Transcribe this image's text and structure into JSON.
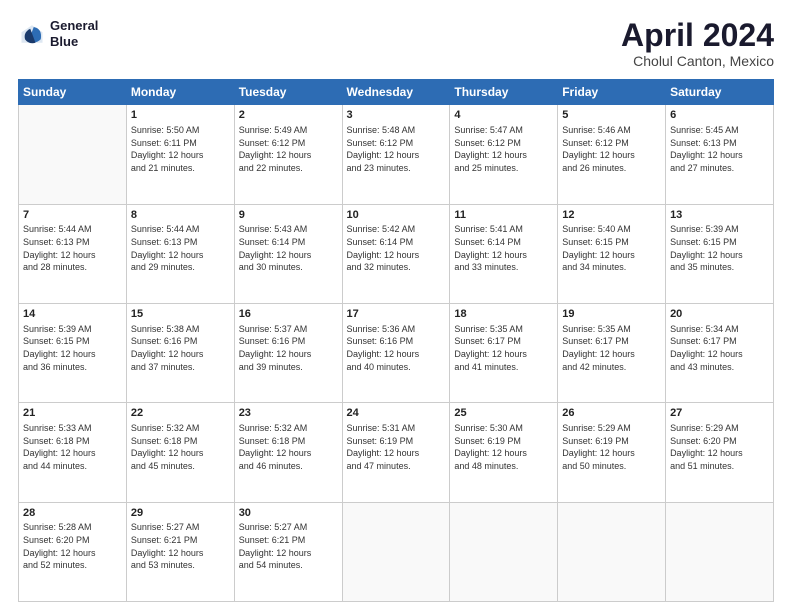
{
  "header": {
    "logo_line1": "General",
    "logo_line2": "Blue",
    "main_title": "April 2024",
    "subtitle": "Cholul Canton, Mexico"
  },
  "weekdays": [
    "Sunday",
    "Monday",
    "Tuesday",
    "Wednesday",
    "Thursday",
    "Friday",
    "Saturday"
  ],
  "weeks": [
    [
      {
        "day": "",
        "info": ""
      },
      {
        "day": "1",
        "info": "Sunrise: 5:50 AM\nSunset: 6:11 PM\nDaylight: 12 hours\nand 21 minutes."
      },
      {
        "day": "2",
        "info": "Sunrise: 5:49 AM\nSunset: 6:12 PM\nDaylight: 12 hours\nand 22 minutes."
      },
      {
        "day": "3",
        "info": "Sunrise: 5:48 AM\nSunset: 6:12 PM\nDaylight: 12 hours\nand 23 minutes."
      },
      {
        "day": "4",
        "info": "Sunrise: 5:47 AM\nSunset: 6:12 PM\nDaylight: 12 hours\nand 25 minutes."
      },
      {
        "day": "5",
        "info": "Sunrise: 5:46 AM\nSunset: 6:12 PM\nDaylight: 12 hours\nand 26 minutes."
      },
      {
        "day": "6",
        "info": "Sunrise: 5:45 AM\nSunset: 6:13 PM\nDaylight: 12 hours\nand 27 minutes."
      }
    ],
    [
      {
        "day": "7",
        "info": "Sunrise: 5:44 AM\nSunset: 6:13 PM\nDaylight: 12 hours\nand 28 minutes."
      },
      {
        "day": "8",
        "info": "Sunrise: 5:44 AM\nSunset: 6:13 PM\nDaylight: 12 hours\nand 29 minutes."
      },
      {
        "day": "9",
        "info": "Sunrise: 5:43 AM\nSunset: 6:14 PM\nDaylight: 12 hours\nand 30 minutes."
      },
      {
        "day": "10",
        "info": "Sunrise: 5:42 AM\nSunset: 6:14 PM\nDaylight: 12 hours\nand 32 minutes."
      },
      {
        "day": "11",
        "info": "Sunrise: 5:41 AM\nSunset: 6:14 PM\nDaylight: 12 hours\nand 33 minutes."
      },
      {
        "day": "12",
        "info": "Sunrise: 5:40 AM\nSunset: 6:15 PM\nDaylight: 12 hours\nand 34 minutes."
      },
      {
        "day": "13",
        "info": "Sunrise: 5:39 AM\nSunset: 6:15 PM\nDaylight: 12 hours\nand 35 minutes."
      }
    ],
    [
      {
        "day": "14",
        "info": "Sunrise: 5:39 AM\nSunset: 6:15 PM\nDaylight: 12 hours\nand 36 minutes."
      },
      {
        "day": "15",
        "info": "Sunrise: 5:38 AM\nSunset: 6:16 PM\nDaylight: 12 hours\nand 37 minutes."
      },
      {
        "day": "16",
        "info": "Sunrise: 5:37 AM\nSunset: 6:16 PM\nDaylight: 12 hours\nand 39 minutes."
      },
      {
        "day": "17",
        "info": "Sunrise: 5:36 AM\nSunset: 6:16 PM\nDaylight: 12 hours\nand 40 minutes."
      },
      {
        "day": "18",
        "info": "Sunrise: 5:35 AM\nSunset: 6:17 PM\nDaylight: 12 hours\nand 41 minutes."
      },
      {
        "day": "19",
        "info": "Sunrise: 5:35 AM\nSunset: 6:17 PM\nDaylight: 12 hours\nand 42 minutes."
      },
      {
        "day": "20",
        "info": "Sunrise: 5:34 AM\nSunset: 6:17 PM\nDaylight: 12 hours\nand 43 minutes."
      }
    ],
    [
      {
        "day": "21",
        "info": "Sunrise: 5:33 AM\nSunset: 6:18 PM\nDaylight: 12 hours\nand 44 minutes."
      },
      {
        "day": "22",
        "info": "Sunrise: 5:32 AM\nSunset: 6:18 PM\nDaylight: 12 hours\nand 45 minutes."
      },
      {
        "day": "23",
        "info": "Sunrise: 5:32 AM\nSunset: 6:18 PM\nDaylight: 12 hours\nand 46 minutes."
      },
      {
        "day": "24",
        "info": "Sunrise: 5:31 AM\nSunset: 6:19 PM\nDaylight: 12 hours\nand 47 minutes."
      },
      {
        "day": "25",
        "info": "Sunrise: 5:30 AM\nSunset: 6:19 PM\nDaylight: 12 hours\nand 48 minutes."
      },
      {
        "day": "26",
        "info": "Sunrise: 5:29 AM\nSunset: 6:19 PM\nDaylight: 12 hours\nand 50 minutes."
      },
      {
        "day": "27",
        "info": "Sunrise: 5:29 AM\nSunset: 6:20 PM\nDaylight: 12 hours\nand 51 minutes."
      }
    ],
    [
      {
        "day": "28",
        "info": "Sunrise: 5:28 AM\nSunset: 6:20 PM\nDaylight: 12 hours\nand 52 minutes."
      },
      {
        "day": "29",
        "info": "Sunrise: 5:27 AM\nSunset: 6:21 PM\nDaylight: 12 hours\nand 53 minutes."
      },
      {
        "day": "30",
        "info": "Sunrise: 5:27 AM\nSunset: 6:21 PM\nDaylight: 12 hours\nand 54 minutes."
      },
      {
        "day": "",
        "info": ""
      },
      {
        "day": "",
        "info": ""
      },
      {
        "day": "",
        "info": ""
      },
      {
        "day": "",
        "info": ""
      }
    ]
  ]
}
